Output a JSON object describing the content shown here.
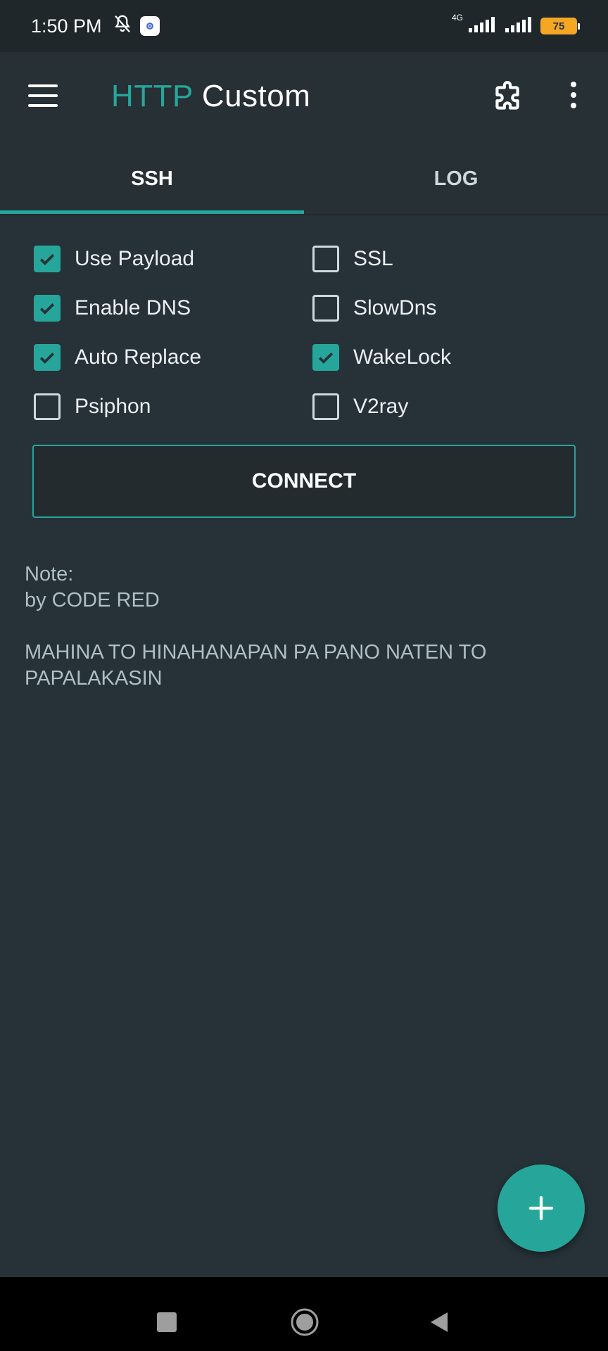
{
  "status_bar": {
    "time": "1:50 PM",
    "network_label": "4G",
    "battery": "75",
    "icons": [
      "bell-off-icon",
      "app-notification-icon",
      "signal-icon",
      "signal-icon",
      "battery-icon"
    ]
  },
  "app_bar": {
    "title_accent": "HTTP",
    "title_rest": " Custom",
    "icons": [
      "menu-icon",
      "puzzle-icon",
      "more-vert-icon"
    ]
  },
  "tabs": [
    {
      "label": "SSH",
      "active": true
    },
    {
      "label": "LOG",
      "active": false
    }
  ],
  "options": [
    {
      "label": "Use Payload",
      "checked": true
    },
    {
      "label": "SSL",
      "checked": false
    },
    {
      "label": "Enable DNS",
      "checked": true
    },
    {
      "label": "SlowDns",
      "checked": false
    },
    {
      "label": "Auto Replace",
      "checked": true
    },
    {
      "label": "WakeLock",
      "checked": true
    },
    {
      "label": "Psiphon",
      "checked": false
    },
    {
      "label": "V2ray",
      "checked": false
    }
  ],
  "connect_label": "CONNECT",
  "note": {
    "line1": "Note:",
    "line2": "by CODE RED",
    "line3": "MAHINA TO HINAHANAPAN PA PANO NATEN TO",
    "line4": "PAPALAKASIN"
  },
  "fab_icon": "plus-icon",
  "nav_icons": [
    "recents-icon",
    "home-icon",
    "back-icon"
  ],
  "colors": {
    "accent": "#26a69a",
    "background": "#263238",
    "battery": "#f5a623"
  }
}
